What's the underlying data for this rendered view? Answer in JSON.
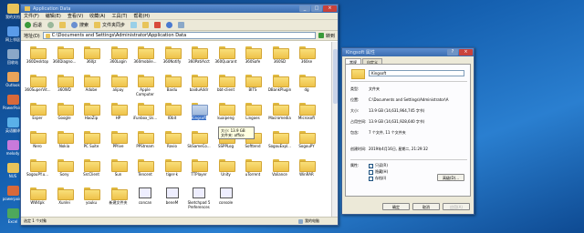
{
  "desktop": {
    "icons": [
      {
        "label": "我的文档",
        "color": "#e8c45a"
      },
      {
        "label": "网上邻居",
        "color": "#5a9be8"
      },
      {
        "label": "回收站",
        "color": "#8aa8c8"
      },
      {
        "label": "Outlook",
        "color": "#e8a45a"
      },
      {
        "label": "PowerPoint",
        "color": "#d8693a"
      },
      {
        "label": "英语翻译",
        "color": "#5ab0e8"
      },
      {
        "label": "melody",
        "color": "#c87adb"
      },
      {
        "label": "NUS",
        "color": "#e8c45a"
      },
      {
        "label": "powerpoint",
        "color": "#d8693a"
      },
      {
        "label": "Excel",
        "color": "#4ea85c"
      }
    ]
  },
  "explorer": {
    "title": "Application Data",
    "menu": [
      "文件(F)",
      "编辑(E)",
      "查看(V)",
      "收藏(A)",
      "工具(T)",
      "帮助(H)"
    ],
    "toolbar": {
      "back": "后退",
      "search": "搜索",
      "folders": "文件夹同步"
    },
    "address_label": "地址(D)",
    "address": "C:\\Documents and Settings\\Administrator\\Application Data",
    "go": "转到",
    "tooltip": {
      "line1": "大小: 13.9 GB",
      "line2": "文件夹: office"
    },
    "status": {
      "left": "选定 1 个对象",
      "right": "我的电脑"
    },
    "rows": [
      [
        "360Desktop",
        "360Diagno...",
        "360jz",
        "360Login",
        "360mobile...",
        "360Notify",
        "360PatiAcct",
        "360Quarant",
        "360Safe",
        "360SD",
        "360se"
      ],
      [
        "360SuperVit...",
        "360WD",
        "Adobe",
        "alipay",
        "Apple Computer",
        "Baidu",
        "baiduAddr",
        "bbt-client",
        "BITS",
        "DBankPlugin",
        "dg"
      ],
      [
        "Esper",
        "Google",
        "HaoZip",
        "HP",
        "iFunbox_Us...",
        "IObit",
        "Kingsoft",
        "kuaipeng",
        "Lingoes",
        "Macromedia",
        "Microsoft"
      ],
      [
        "Nero",
        "Nokia",
        "PC Suite",
        "PPlive",
        "PPStream",
        "Rovio",
        "SkSameCo...",
        "SSPPLog",
        "Softtend",
        "SogouExpl...",
        "SogouPY"
      ],
      [
        "SogouPY.u...",
        "Sony",
        "SrcClient",
        "Sun",
        "Tencent",
        "tiger-k",
        "TTPlayer",
        "Unity",
        "uTorrent",
        "Valiance",
        "WinRAR"
      ],
      [
        "WW4pk",
        "Xunlei",
        "youku",
        "新建文件夹",
        "concan",
        "beneM",
        "Sketchpad 5 Preferences",
        "console"
      ]
    ]
  },
  "dialog": {
    "title": "Kingsoft 属性",
    "tabs": [
      "常规",
      "自定义"
    ],
    "name": "Kingsoft",
    "fields": [
      {
        "k": "类型:",
        "v": "文件夹"
      },
      {
        "k": "位置:",
        "v": "C:\\Documents and Settings\\Administrator\\A"
      },
      {
        "k": "大小:",
        "v": "13.9 GB (14,631,964,745 字节)"
      },
      {
        "k": "占用空间:",
        "v": "13.9 GB (14,631,928,640 字节)"
      },
      {
        "k": "包含:",
        "v": "7 个文件, 11 个文件夹"
      },
      {
        "k": "创建时间:",
        "v": "2019年4月16日, 星期二, 21:29:32"
      }
    ],
    "attr_label": "属性:",
    "attrs": [
      {
        "label": "只读(R)",
        "checked": true
      },
      {
        "label": "隐藏(H)",
        "checked": false
      },
      {
        "label": "存档(I)",
        "checked": false
      }
    ],
    "advanced": "高级(D)...",
    "buttons": {
      "ok": "确定",
      "cancel": "取消",
      "apply": "应用(A)"
    }
  }
}
